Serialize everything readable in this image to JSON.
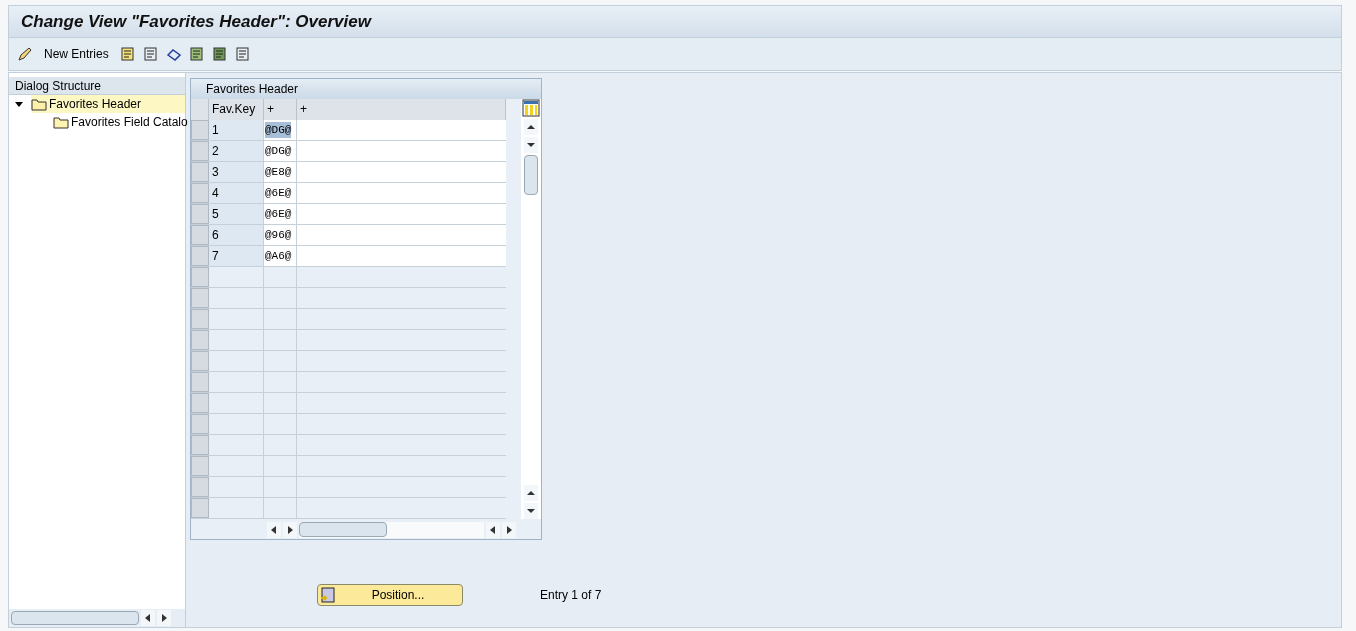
{
  "window": {
    "title": "Change View \"Favorites Header\": Overview"
  },
  "toolbar": {
    "new_entries": "New Entries"
  },
  "dialog_structure": {
    "title": "Dialog Structure",
    "items": [
      {
        "label": "Favorites Header",
        "selected": true,
        "expanded": true,
        "children": [
          {
            "label": "Favorites Field Catalo",
            "selected": false
          }
        ]
      }
    ]
  },
  "table": {
    "title": "Favorites Header",
    "columns": [
      "Fav.Key",
      "+",
      "+"
    ],
    "rows": [
      {
        "key": "1",
        "code": "@DG@",
        "selected": true
      },
      {
        "key": "2",
        "code": "@DG@",
        "selected": false
      },
      {
        "key": "3",
        "code": "@E8@",
        "selected": false
      },
      {
        "key": "4",
        "code": "@6E@",
        "selected": false
      },
      {
        "key": "5",
        "code": "@6E@",
        "selected": false
      },
      {
        "key": "6",
        "code": "@96@",
        "selected": false
      },
      {
        "key": "7",
        "code": "@A6@",
        "selected": false
      }
    ]
  },
  "position_button": "Position...",
  "entry_info": "Entry 1 of 7"
}
